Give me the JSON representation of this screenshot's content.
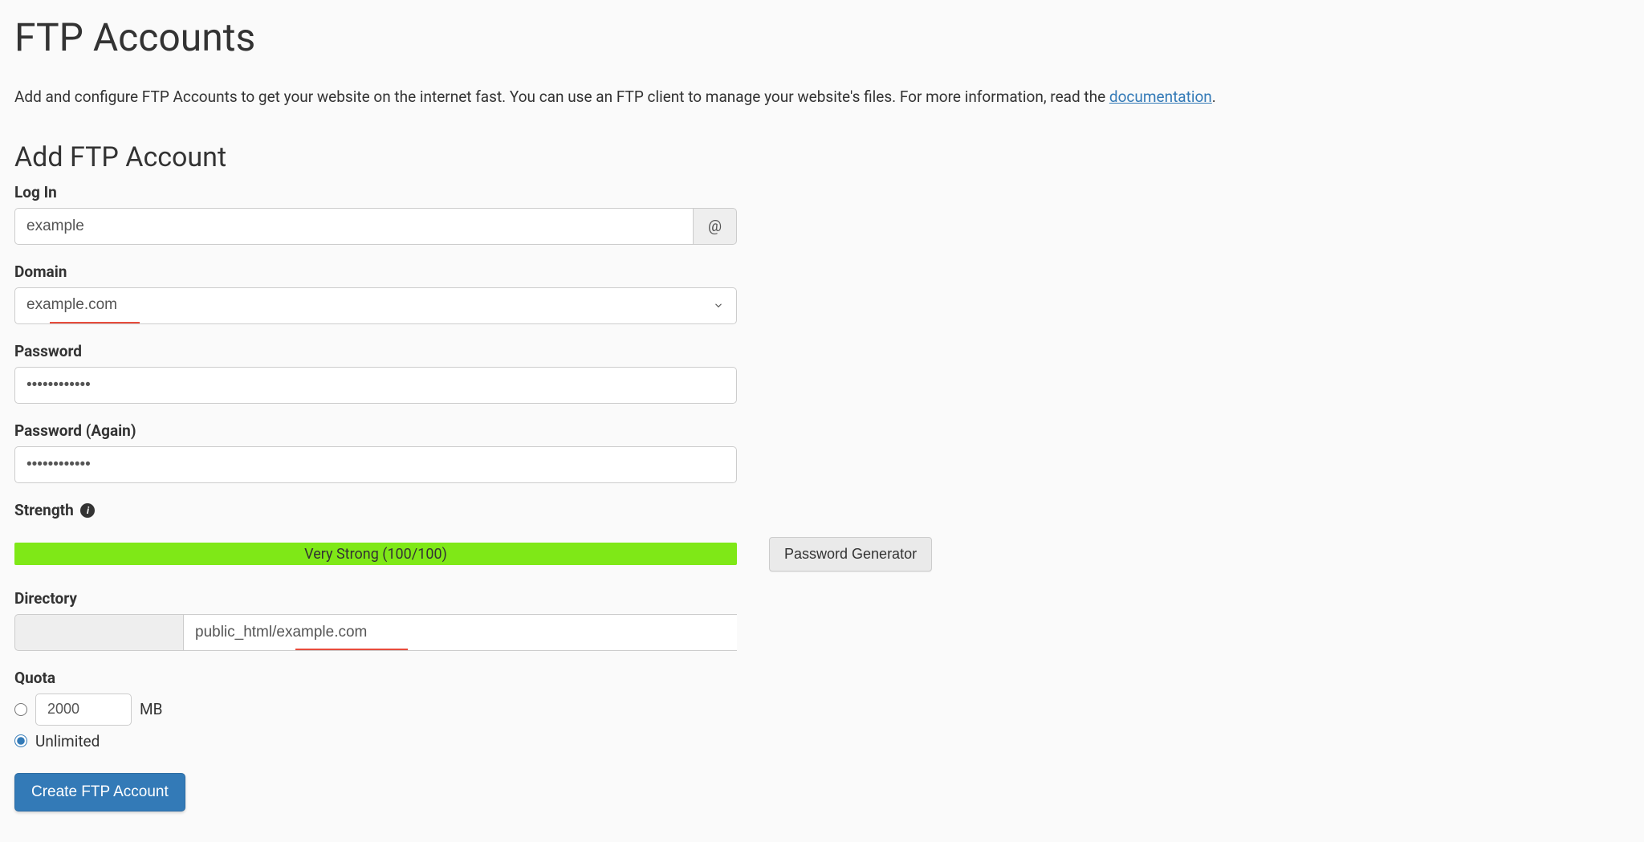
{
  "page": {
    "title": "FTP Accounts",
    "intro_text": "Add and configure FTP Accounts to get your website on the internet fast. You can use an FTP client to manage your website's files. For more information, read the ",
    "doc_link_text": "documentation",
    "intro_suffix": "."
  },
  "form": {
    "section_title": "Add FTP Account",
    "login_label": "Log In",
    "login_value": "example",
    "at_symbol": "@",
    "domain_label": "Domain",
    "domain_value": "example.com",
    "password_label": "Password",
    "password_value": "••••••••••••",
    "password_again_label": "Password (Again)",
    "password_again_value": "••••••••••••",
    "strength_label": "Strength",
    "strength_text": "Very Strong (100/100)",
    "password_generator_label": "Password Generator",
    "directory_label": "Directory",
    "directory_prefix": " ",
    "directory_value": "public_html/example.com",
    "quota_label": "Quota",
    "quota_value": "2000",
    "quota_unit": "MB",
    "unlimited_label": "Unlimited",
    "submit_label": "Create FTP Account"
  }
}
